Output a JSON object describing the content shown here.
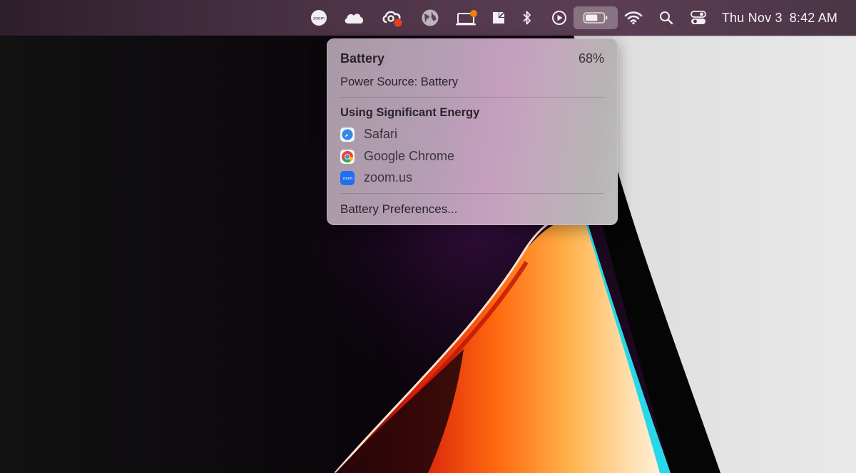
{
  "menubar": {
    "icons": [
      "zoom-icon",
      "cloud-icon",
      "creative-cloud-icon",
      "globe-icon",
      "laptop-icon",
      "notes-icon",
      "bluetooth-icon",
      "play-icon",
      "battery-icon",
      "wifi-icon",
      "search-icon",
      "control-center-icon"
    ],
    "zoom_text": "zoom",
    "date": "Thu Nov 3",
    "time": "8:42 AM"
  },
  "battery_menu": {
    "title": "Battery",
    "percent": "68%",
    "level": 0.68,
    "power_source": "Power Source: Battery",
    "section_title": "Using Significant Energy",
    "apps": [
      {
        "name": "Safari",
        "icon": "safari-icon"
      },
      {
        "name": "Google Chrome",
        "icon": "chrome-icon"
      },
      {
        "name": "zoom.us",
        "icon": "zoom-app-icon",
        "icon_text": "zoom"
      }
    ],
    "preferences_label": "Battery Preferences..."
  },
  "colors": {
    "menubar": "#4d3447",
    "menu_bg": "#c59fbe",
    "zoom_blue": "#1f6ff2",
    "notification_orange": "#f0820a",
    "notification_red": "#e8401c"
  }
}
